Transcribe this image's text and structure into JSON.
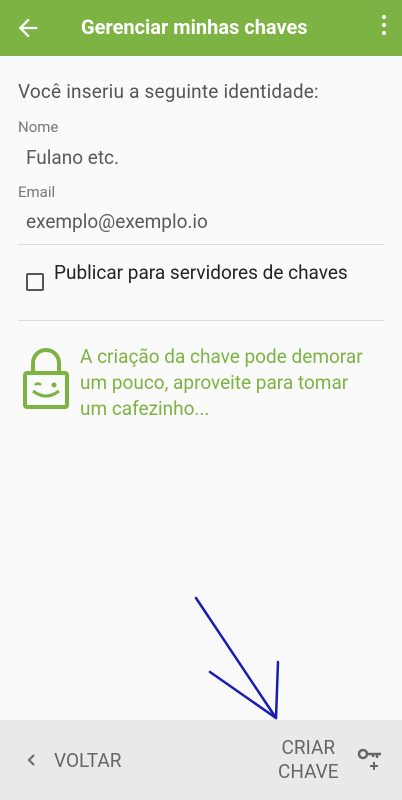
{
  "header": {
    "title": "Gerenciar minhas chaves"
  },
  "form": {
    "intro": "Você inseriu a seguinte identidade:",
    "name_label": "Nome",
    "name_value": "Fulano etc.",
    "email_label": "Email",
    "email_value": "exemplo@exemplo.io",
    "publish_label": "Publicar para servidores de chaves",
    "publish_checked": false
  },
  "notice": {
    "text": "A criação da chave pode demorar um pouco, aproveite para tomar um cafezinho..."
  },
  "footer": {
    "back_label": "VOLTAR",
    "create_line1": "CRIAR",
    "create_line2": "CHAVE"
  },
  "colors": {
    "accent": "#7cb342",
    "annotation": "#1a1ab5"
  },
  "icons": [
    "back-arrow-icon",
    "more-vert-icon",
    "lock-icon",
    "chevron-left-icon",
    "key-plus-icon"
  ]
}
